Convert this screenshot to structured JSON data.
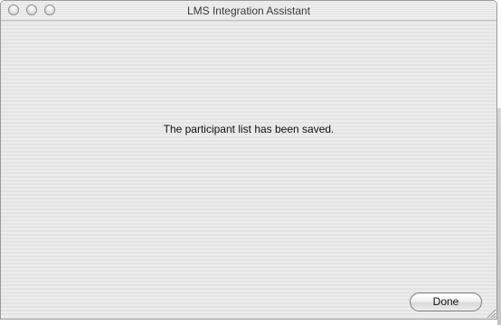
{
  "window": {
    "title": "LMS Integration Assistant"
  },
  "content": {
    "message": "The participant list has been saved."
  },
  "buttons": {
    "done_label": "Done"
  },
  "icons": {
    "close": "window-close-button",
    "minimize": "window-minimize-button",
    "zoom": "window-zoom-button",
    "resize": "resize-grip-icon"
  },
  "colors": {
    "window_background": "#ececec",
    "text": "#111111",
    "title_text": "#3a3a3a"
  }
}
